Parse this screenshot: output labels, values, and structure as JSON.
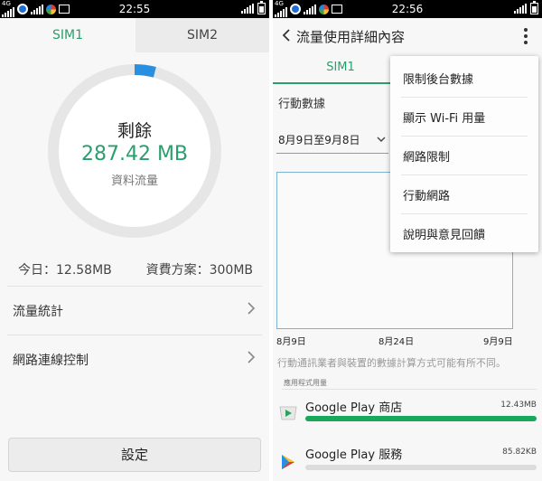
{
  "left": {
    "status": {
      "network": "4G",
      "time": "22:55"
    },
    "tabs": [
      "SIM1",
      "SIM2"
    ],
    "ring": {
      "remaining_label": "剩餘",
      "remaining_amount": "287.42 MB",
      "data_type": "資料流量",
      "used_fraction": 0.04
    },
    "summary": {
      "today": "今日：12.58MB",
      "plan": "資費方案：300MB"
    },
    "menu": [
      "流量統計",
      "網路連線控制"
    ],
    "settings_button": "設定",
    "colors": {
      "accent": "#2a9e6d",
      "ring_used": "#2b8fe0",
      "ring_track": "#e6e6e6"
    }
  },
  "right": {
    "status": {
      "network": "4G",
      "time": "22:56"
    },
    "title": "流量使用詳細內容",
    "tab": "SIM1",
    "section_mobile": "行動數據",
    "date_range": "8月9日至9月8日",
    "x_labels": [
      "8月9日",
      "8月24日",
      "9月9日"
    ],
    "note": "行動通訊業者與裝置的數據計算方式可能有所不同。",
    "app_usage_header": "應用程式用量",
    "apps": [
      {
        "name": "Google Play 商店",
        "size": "12.43MB",
        "fraction": 1.0
      },
      {
        "name": "Google Play 服務",
        "size": "85.82KB",
        "fraction": 0.0
      }
    ],
    "overflow_menu": [
      "限制後台數據",
      "顯示 Wi-Fi 用量",
      "網路限制",
      "行動網路",
      "說明與意見回饋"
    ]
  }
}
